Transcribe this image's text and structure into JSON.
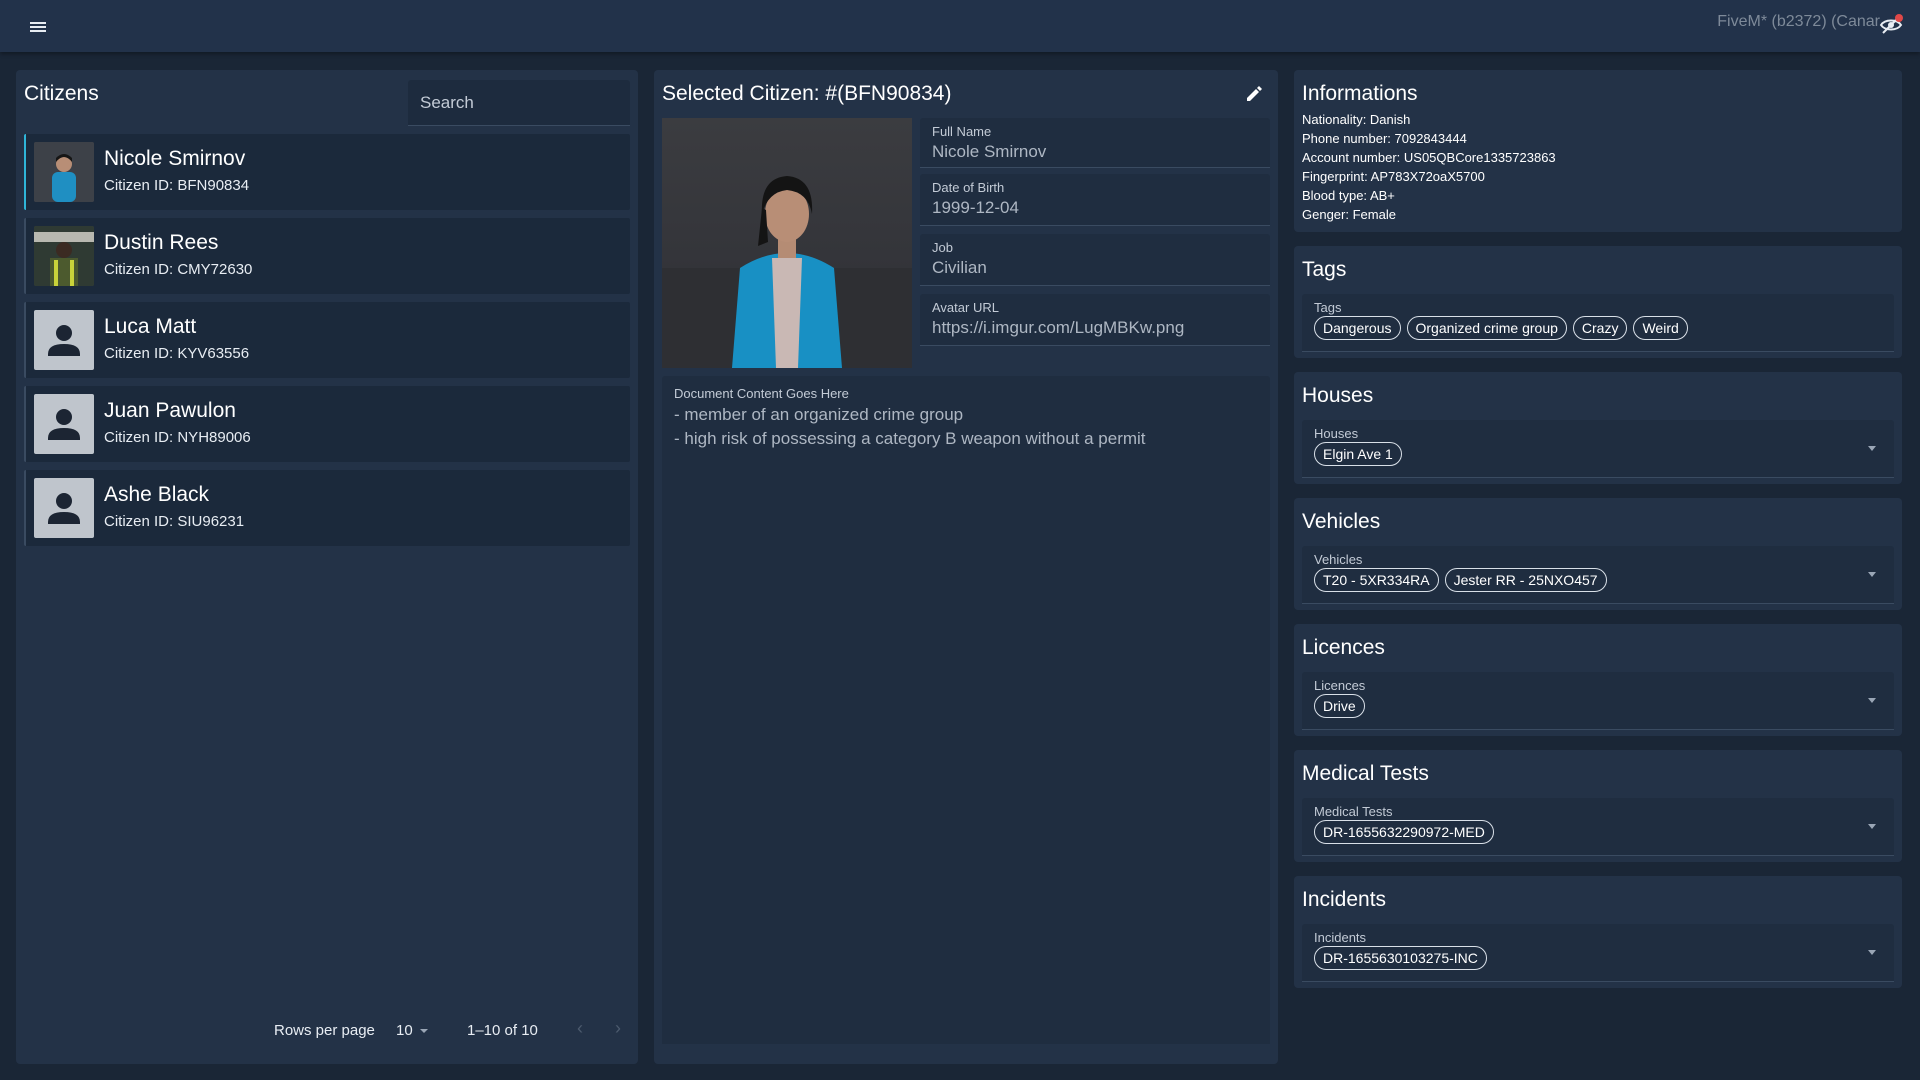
{
  "topbar": {
    "menu_icon": "menu-icon",
    "build_text": "FiveM* (b2372) (Canar",
    "status_icon": "eye-off-icon"
  },
  "citizens": {
    "title": "Citizens",
    "search_placeholder": "Search",
    "items": [
      {
        "name": "Nicole Smirnov",
        "id": "Citizen ID: BFN90834",
        "avatar": "photo"
      },
      {
        "name": "Dustin Rees",
        "id": "Citizen ID: CMY72630",
        "avatar": "photo"
      },
      {
        "name": "Luca Matt",
        "id": "Citizen ID: KYV63556",
        "avatar": "person-icon"
      },
      {
        "name": "Juan Pawulon",
        "id": "Citizen ID: NYH89006",
        "avatar": "person-icon"
      },
      {
        "name": "Ashe Black",
        "id": "Citizen ID: SIU96231",
        "avatar": "person-icon"
      }
    ],
    "pagination": {
      "rows_per_page_label": "Rows per page",
      "rows_per_page": "10",
      "range": "1–10 of 10",
      "prev": "‹",
      "next": "›"
    }
  },
  "detail": {
    "title": "Selected Citizen: #(BFN90834)",
    "edit_icon": "pencil-icon",
    "fields": {
      "full_name": {
        "label": "Full Name",
        "value": "Nicole Smirnov"
      },
      "dob": {
        "label": "Date of Birth",
        "value": "1999-12-04"
      },
      "job": {
        "label": "Job",
        "value": "Civilian"
      },
      "avatar_url": {
        "label": "Avatar URL",
        "value": "https://i.imgur.com/LugMBKw.png"
      }
    },
    "document": {
      "label": "Document Content Goes Here",
      "lines": [
        "- member of an organized crime group",
        "- high risk of possessing a category B weapon without a permit"
      ]
    }
  },
  "informations": {
    "title": "Informations",
    "lines": [
      "Nationality: Danish",
      "Phone number: 7092843444",
      "Account number: US05QBCore1335723863",
      "Fingerprint: AP783X72oaX5700",
      "Blood type: AB+",
      "Genger: Female"
    ]
  },
  "tags": {
    "title": "Tags",
    "label": "Tags",
    "chips": [
      "Dangerous",
      "Organized crime group",
      "Crazy",
      "Weird"
    ]
  },
  "houses": {
    "title": "Houses",
    "label": "Houses",
    "chips": [
      "Elgin Ave 1"
    ]
  },
  "vehicles": {
    "title": "Vehicles",
    "label": "Vehicles",
    "chips": [
      "T20 - 5XR334RA",
      "Jester RR - 25NXO457"
    ]
  },
  "licences": {
    "title": "Licences",
    "label": "Licences",
    "chips": [
      "Drive"
    ]
  },
  "medical": {
    "title": "Medical Tests",
    "label": "Medical Tests",
    "chips": [
      "DR-1655632290972-MED"
    ]
  },
  "incidents": {
    "title": "Incidents",
    "label": "Incidents",
    "chips": [
      "DR-1655630103275-INC"
    ]
  },
  "colors": {
    "background": "#1a2636",
    "panel": "#233247",
    "accent": "#2fb5d8",
    "field": "#1f2d40"
  }
}
